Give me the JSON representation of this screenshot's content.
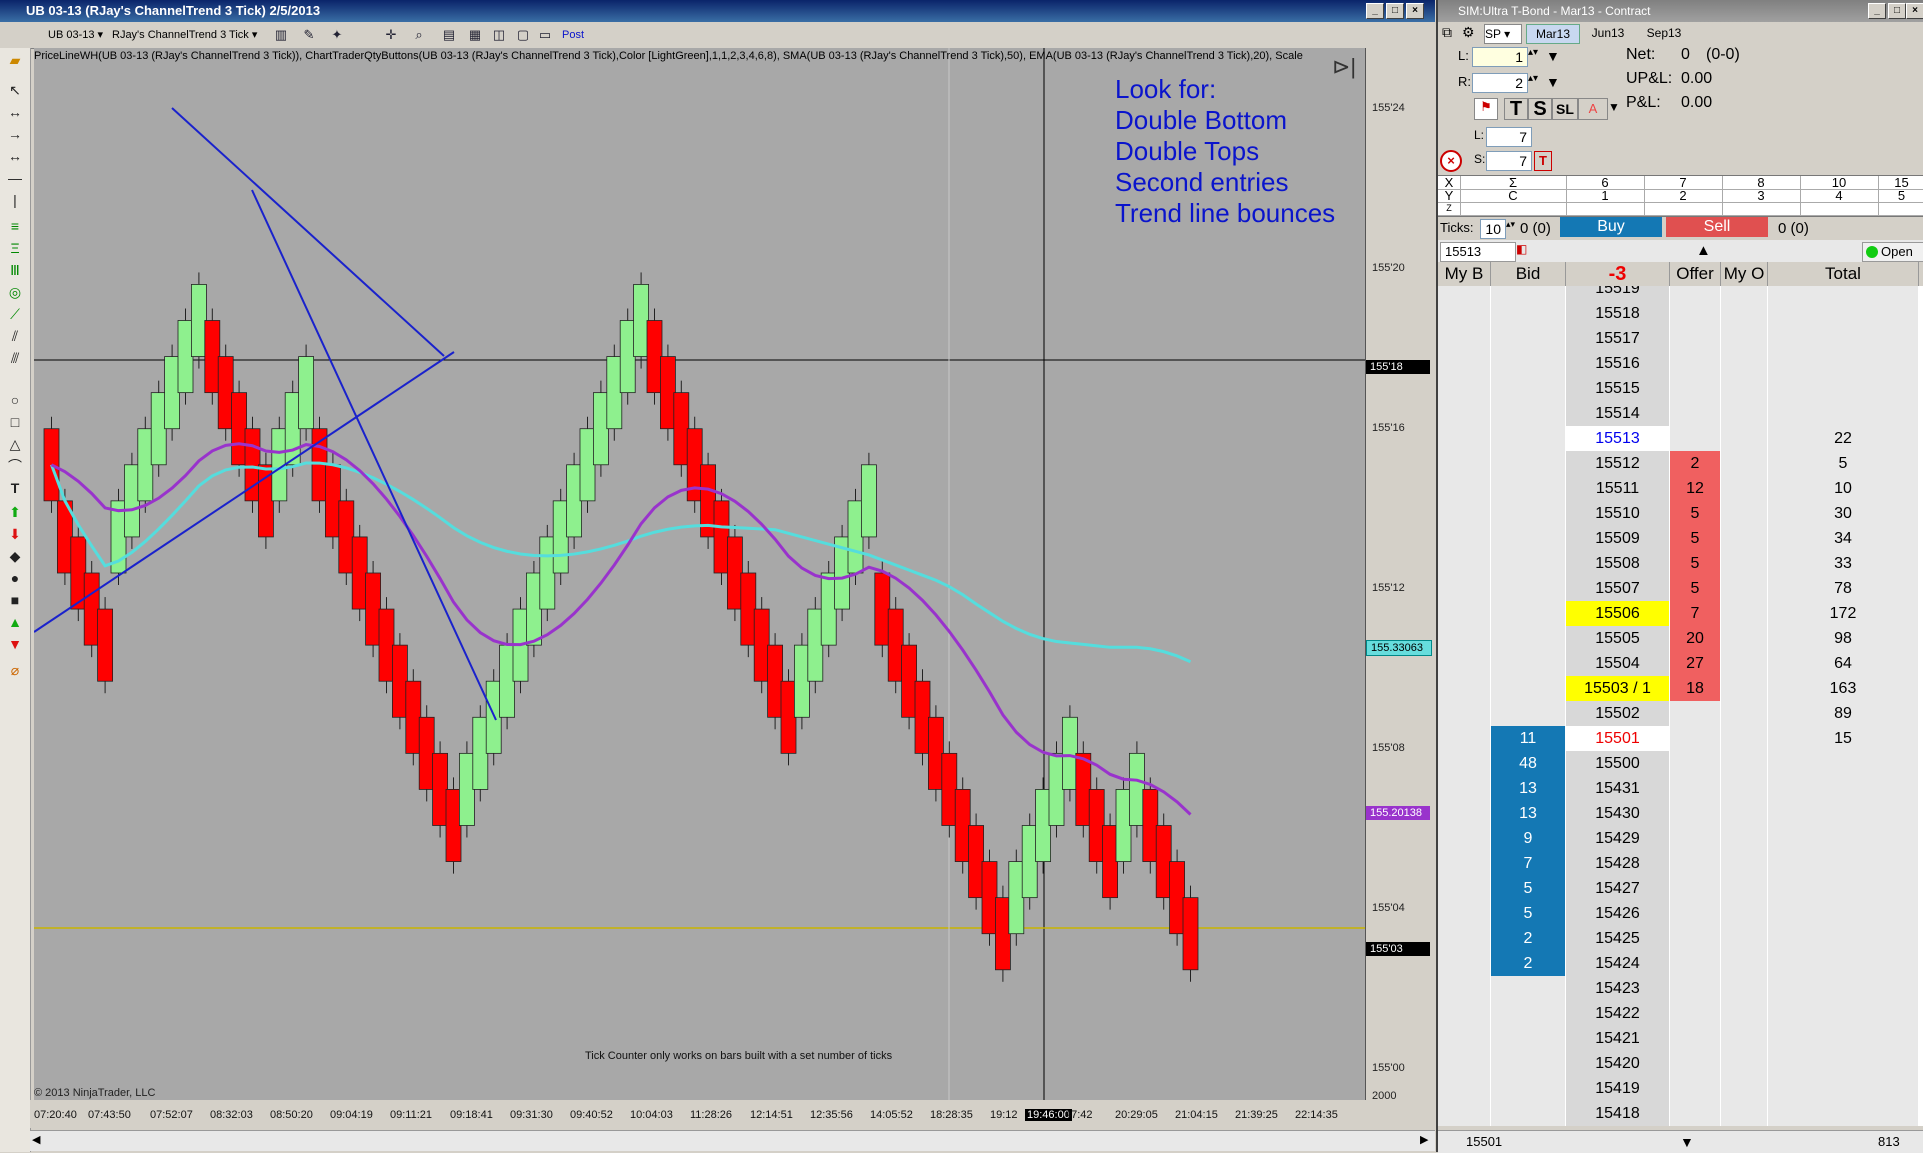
{
  "chart_window": {
    "title": "UB 03-13 (RJay's ChannelTrend  3 Tick)  2/5/2013",
    "toolbar": {
      "instrument": "UB 03-13",
      "bartype": "RJay's ChannelTrend  3 Tick",
      "post_label": "Post"
    },
    "indicator_line": "PriceLineWH(UB 03-13 (RJay's ChannelTrend  3 Tick)), ChartTraderQtyButtons(UB 03-13 (RJay's ChannelTrend  3 Tick),Color [LightGreen],1,1,2,3,4,6,8), SMA(UB 03-13 (RJay's ChannelTrend  3 Tick),50), EMA(UB 03-13 (RJay's ChannelTrend  3 Tick),20), Scale",
    "annotation": [
      "Look for:",
      "Double Bottom",
      "Double Tops",
      "Second entries",
      "Trend line bounces"
    ],
    "footer_note": "Tick Counter only works on bars built with a set number of ticks",
    "copyright": "© 2013 NinjaTrader, LLC",
    "y_ticks": [
      "155'24",
      "155'20",
      "155'16",
      "155'12",
      "155'08",
      "155'04",
      "155'00"
    ],
    "y_markers": [
      {
        "label": "155'18",
        "bg": "#000000",
        "fg": "#ffffff"
      },
      {
        "label": "155.33063",
        "bg": "#66dddd",
        "fg": "#000000"
      },
      {
        "label": "155.20138",
        "bg": "#9933cc",
        "fg": "#ffffff"
      },
      {
        "label": "155'03",
        "bg": "#000000",
        "fg": "#ffffff"
      }
    ],
    "y_bottom_label": "2000",
    "x_ticks": [
      "07:20:40",
      "07:43:50",
      "07:52:07",
      "08:32:03",
      "08:50:20",
      "09:04:19",
      "09:11:21",
      "09:18:41",
      "09:31:30",
      "09:40:52",
      "10:04:03",
      "11:28:26",
      "12:14:51",
      "12:35:56",
      "14:05:52",
      "18:28:35",
      "19:12",
      "19:46:00",
      "47:42",
      "20:29:05",
      "21:04:15",
      "21:39:25",
      "22:14:35"
    ],
    "colors": {
      "up_bar": "#8ef08e",
      "down_bar": "#ff0000",
      "sma": "#55dddd",
      "ema": "#9933cc",
      "trendline": "#1a22cc",
      "annotation": "#0a14cc"
    }
  },
  "chart_data": {
    "type": "candlestick",
    "title": "UB 03-13 (RJay's ChannelTrend  3 Tick)  2/5/2013",
    "ylim": [
      154.9375,
      155.8125
    ],
    "series": [
      {
        "name": "SMA(UB 03-13 (RJay's ChannelTrend  3 Tick),50)",
        "last": 155.33063
      },
      {
        "name": "EMA(UB 03-13 (RJay's ChannelTrend  3 Tick),20)",
        "last": 155.20138
      }
    ],
    "last_price": "155'03",
    "bars": [
      {
        "dir": "down",
        "o": 155.5,
        "c": 155.4375
      },
      {
        "dir": "down",
        "o": 155.4375,
        "c": 155.375
      },
      {
        "dir": "down",
        "o": 155.40625,
        "c": 155.34375
      },
      {
        "dir": "down",
        "o": 155.375,
        "c": 155.3125
      },
      {
        "dir": "down",
        "o": 155.34375,
        "c": 155.28125
      },
      {
        "dir": "up",
        "o": 155.375,
        "c": 155.4375
      },
      {
        "dir": "up",
        "o": 155.40625,
        "c": 155.46875
      },
      {
        "dir": "up",
        "o": 155.4375,
        "c": 155.5
      },
      {
        "dir": "up",
        "o": 155.46875,
        "c": 155.53125
      },
      {
        "dir": "up",
        "o": 155.5,
        "c": 155.5625
      },
      {
        "dir": "up",
        "o": 155.53125,
        "c": 155.59375
      },
      {
        "dir": "up",
        "o": 155.5625,
        "c": 155.625
      },
      {
        "dir": "down",
        "o": 155.59375,
        "c": 155.53125
      },
      {
        "dir": "down",
        "o": 155.5625,
        "c": 155.5
      },
      {
        "dir": "down",
        "o": 155.53125,
        "c": 155.46875
      },
      {
        "dir": "down",
        "o": 155.5,
        "c": 155.4375
      },
      {
        "dir": "down",
        "o": 155.46875,
        "c": 155.40625
      },
      {
        "dir": "up",
        "o": 155.4375,
        "c": 155.5
      },
      {
        "dir": "up",
        "o": 155.46875,
        "c": 155.53125
      },
      {
        "dir": "up",
        "o": 155.5,
        "c": 155.5625
      },
      {
        "dir": "down",
        "o": 155.5,
        "c": 155.4375
      },
      {
        "dir": "down",
        "o": 155.46875,
        "c": 155.40625
      },
      {
        "dir": "down",
        "o": 155.4375,
        "c": 155.375
      },
      {
        "dir": "down",
        "o": 155.40625,
        "c": 155.34375
      },
      {
        "dir": "down",
        "o": 155.375,
        "c": 155.3125
      },
      {
        "dir": "down",
        "o": 155.34375,
        "c": 155.28125
      },
      {
        "dir": "down",
        "o": 155.3125,
        "c": 155.25
      },
      {
        "dir": "down",
        "o": 155.28125,
        "c": 155.21875
      },
      {
        "dir": "down",
        "o": 155.25,
        "c": 155.1875
      },
      {
        "dir": "down",
        "o": 155.21875,
        "c": 155.15625
      },
      {
        "dir": "down",
        "o": 155.1875,
        "c": 155.125
      },
      {
        "dir": "up",
        "o": 155.15625,
        "c": 155.21875
      },
      {
        "dir": "up",
        "o": 155.1875,
        "c": 155.25
      },
      {
        "dir": "up",
        "o": 155.21875,
        "c": 155.28125
      },
      {
        "dir": "up",
        "o": 155.25,
        "c": 155.3125
      },
      {
        "dir": "up",
        "o": 155.28125,
        "c": 155.34375
      },
      {
        "dir": "up",
        "o": 155.3125,
        "c": 155.375
      },
      {
        "dir": "up",
        "o": 155.34375,
        "c": 155.40625
      },
      {
        "dir": "up",
        "o": 155.375,
        "c": 155.4375
      },
      {
        "dir": "up",
        "o": 155.40625,
        "c": 155.46875
      },
      {
        "dir": "up",
        "o": 155.4375,
        "c": 155.5
      },
      {
        "dir": "up",
        "o": 155.46875,
        "c": 155.53125
      },
      {
        "dir": "up",
        "o": 155.5,
        "c": 155.5625
      },
      {
        "dir": "up",
        "o": 155.53125,
        "c": 155.59375
      },
      {
        "dir": "up",
        "o": 155.5625,
        "c": 155.625
      },
      {
        "dir": "down",
        "o": 155.59375,
        "c": 155.53125
      },
      {
        "dir": "down",
        "o": 155.5625,
        "c": 155.5
      },
      {
        "dir": "down",
        "o": 155.53125,
        "c": 155.46875
      },
      {
        "dir": "down",
        "o": 155.5,
        "c": 155.4375
      },
      {
        "dir": "down",
        "o": 155.46875,
        "c": 155.40625
      },
      {
        "dir": "down",
        "o": 155.4375,
        "c": 155.375
      },
      {
        "dir": "down",
        "o": 155.40625,
        "c": 155.34375
      },
      {
        "dir": "down",
        "o": 155.375,
        "c": 155.3125
      },
      {
        "dir": "down",
        "o": 155.34375,
        "c": 155.28125
      },
      {
        "dir": "down",
        "o": 155.3125,
        "c": 155.25
      },
      {
        "dir": "down",
        "o": 155.28125,
        "c": 155.21875
      },
      {
        "dir": "up",
        "o": 155.25,
        "c": 155.3125
      },
      {
        "dir": "up",
        "o": 155.28125,
        "c": 155.34375
      },
      {
        "dir": "up",
        "o": 155.3125,
        "c": 155.375
      },
      {
        "dir": "up",
        "o": 155.34375,
        "c": 155.40625
      },
      {
        "dir": "up",
        "o": 155.375,
        "c": 155.4375
      },
      {
        "dir": "up",
        "o": 155.40625,
        "c": 155.46875
      },
      {
        "dir": "down",
        "o": 155.375,
        "c": 155.3125
      },
      {
        "dir": "down",
        "o": 155.34375,
        "c": 155.28125
      },
      {
        "dir": "down",
        "o": 155.3125,
        "c": 155.25
      },
      {
        "dir": "down",
        "o": 155.28125,
        "c": 155.21875
      },
      {
        "dir": "down",
        "o": 155.25,
        "c": 155.1875
      },
      {
        "dir": "down",
        "o": 155.21875,
        "c": 155.15625
      },
      {
        "dir": "down",
        "o": 155.1875,
        "c": 155.125
      },
      {
        "dir": "down",
        "o": 155.15625,
        "c": 155.09375
      },
      {
        "dir": "down",
        "o": 155.125,
        "c": 155.0625
      },
      {
        "dir": "down",
        "o": 155.09375,
        "c": 155.03125
      },
      {
        "dir": "up",
        "o": 155.0625,
        "c": 155.125
      },
      {
        "dir": "up",
        "o": 155.09375,
        "c": 155.15625
      },
      {
        "dir": "up",
        "o": 155.125,
        "c": 155.1875
      },
      {
        "dir": "up",
        "o": 155.15625,
        "c": 155.21875
      },
      {
        "dir": "up",
        "o": 155.1875,
        "c": 155.25
      },
      {
        "dir": "down",
        "o": 155.21875,
        "c": 155.15625
      },
      {
        "dir": "down",
        "o": 155.1875,
        "c": 155.125
      },
      {
        "dir": "down",
        "o": 155.15625,
        "c": 155.09375
      },
      {
        "dir": "up",
        "o": 155.125,
        "c": 155.1875
      },
      {
        "dir": "up",
        "o": 155.15625,
        "c": 155.21875
      },
      {
        "dir": "down",
        "o": 155.1875,
        "c": 155.125
      },
      {
        "dir": "down",
        "o": 155.15625,
        "c": 155.09375
      },
      {
        "dir": "down",
        "o": 155.125,
        "c": 155.0625
      },
      {
        "dir": "down",
        "o": 155.09375,
        "c": 155.03125
      }
    ]
  },
  "dom_window": {
    "title": "SIM:Ultra T-Bond - Mar13 - Contract",
    "tabs": [
      "Mar13",
      "Jun13",
      "Sep13"
    ],
    "account_short": "SP",
    "l_value": "1",
    "r_value": "2",
    "net_label": "Net:",
    "net_value": "0",
    "net_paren": "(0-0)",
    "upl_label": "UP&L:",
    "upl_value": "0.00",
    "pl_label": "P&L:",
    "pl_value": "0.00",
    "l2_label": "L:",
    "l2_value": "7",
    "s_label": "S:",
    "s_value": "7",
    "qty_rows": [
      [
        "X",
        "Σ",
        "6",
        "7",
        "8",
        "10",
        "15"
      ],
      [
        "Y",
        "C",
        "1",
        "2",
        "3",
        "4",
        "5"
      ],
      [
        "Z",
        "",
        "",
        "",
        "",
        "",
        ""
      ]
    ],
    "ticks_label": "Ticks:",
    "ticks_value": "10",
    "buy_paren": "0 (0)",
    "buy_label": "Buy",
    "sell_label": "Sell",
    "sell_paren": "0 (0)",
    "price_field": "15513",
    "open_label": "Open",
    "headers": {
      "my_bid": "My B",
      "bid": "Bid",
      "center": "-3",
      "offer": "Offer",
      "my_offer": "My O",
      "total": "Total"
    },
    "ladder": [
      {
        "price": "15519",
        "bid": "",
        "offer": "",
        "total": ""
      },
      {
        "price": "15518",
        "bid": "",
        "offer": "",
        "total": ""
      },
      {
        "price": "15517",
        "bid": "",
        "offer": "",
        "total": ""
      },
      {
        "price": "15516",
        "bid": "",
        "offer": "",
        "total": ""
      },
      {
        "price": "15515",
        "bid": "",
        "offer": "",
        "total": ""
      },
      {
        "price": "15514",
        "bid": "",
        "offer": "",
        "total": ""
      },
      {
        "price": "15513",
        "bid": "",
        "offer": "",
        "total": "22",
        "style": "highlight"
      },
      {
        "price": "15512",
        "bid": "",
        "offer": "2",
        "total": "5"
      },
      {
        "price": "15511",
        "bid": "",
        "offer": "12",
        "total": "10"
      },
      {
        "price": "15510",
        "bid": "",
        "offer": "5",
        "total": "30"
      },
      {
        "price": "15509",
        "bid": "",
        "offer": "5",
        "total": "34"
      },
      {
        "price": "15508",
        "bid": "",
        "offer": "5",
        "total": "33"
      },
      {
        "price": "15507",
        "bid": "",
        "offer": "5",
        "total": "78"
      },
      {
        "price": "15506",
        "bid": "",
        "offer": "7",
        "total": "172",
        "style": "yellow"
      },
      {
        "price": "15505",
        "bid": "",
        "offer": "20",
        "total": "98"
      },
      {
        "price": "15504",
        "bid": "",
        "offer": "27",
        "total": "64"
      },
      {
        "price": "15503 / 1",
        "bid": "",
        "offer": "18",
        "total": "163",
        "style": "yellow"
      },
      {
        "price": "15502",
        "bid": "",
        "offer": "",
        "total": "89"
      },
      {
        "price": "15501",
        "bid": "11",
        "offer": "",
        "total": "15",
        "style": "last"
      },
      {
        "price": "15500",
        "bid": "48",
        "offer": "",
        "total": ""
      },
      {
        "price": "15431",
        "bid": "13",
        "offer": "",
        "total": ""
      },
      {
        "price": "15430",
        "bid": "13",
        "offer": "",
        "total": ""
      },
      {
        "price": "15429",
        "bid": "9",
        "offer": "",
        "total": ""
      },
      {
        "price": "15428",
        "bid": "7",
        "offer": "",
        "total": ""
      },
      {
        "price": "15427",
        "bid": "5",
        "offer": "",
        "total": ""
      },
      {
        "price": "15426",
        "bid": "5",
        "offer": "",
        "total": ""
      },
      {
        "price": "15425",
        "bid": "2",
        "offer": "",
        "total": ""
      },
      {
        "price": "15424",
        "bid": "2",
        "offer": "",
        "total": ""
      },
      {
        "price": "15423",
        "bid": "",
        "offer": "",
        "total": ""
      },
      {
        "price": "15422",
        "bid": "",
        "offer": "",
        "total": ""
      },
      {
        "price": "15421",
        "bid": "",
        "offer": "",
        "total": ""
      },
      {
        "price": "15420",
        "bid": "",
        "offer": "",
        "total": ""
      },
      {
        "price": "15419",
        "bid": "",
        "offer": "",
        "total": ""
      },
      {
        "price": "15418",
        "bid": "",
        "offer": "",
        "total": ""
      }
    ],
    "bottom_left": "15501",
    "bottom_right": "813"
  }
}
